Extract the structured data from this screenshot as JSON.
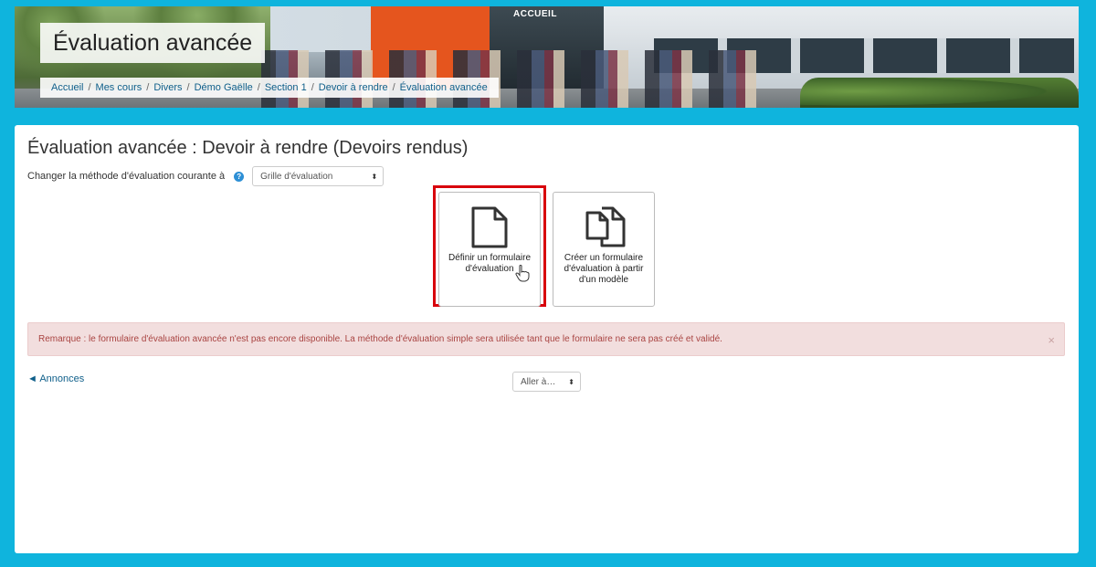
{
  "header": {
    "title": "Évaluation avancée",
    "banner_sign": "ACCUEIL",
    "breadcrumb": [
      "Accueil",
      "Mes cours",
      "Divers",
      "Démo Gaëlle",
      "Section 1",
      "Devoir à rendre",
      "Évaluation avancée"
    ],
    "breadcrumb_separator": "/"
  },
  "main": {
    "title": "Évaluation avancée : Devoir à rendre (Devoirs rendus)",
    "method_label": "Changer la méthode d'évaluation courante à",
    "method_select_value": "Grille d'évaluation",
    "tiles": [
      {
        "label": "Définir un formulaire d'évaluation",
        "icon": "document-icon"
      },
      {
        "label": "Créer un formulaire d'évaluation à partir d'un modèle",
        "icon": "copy-documents-icon"
      }
    ],
    "alert": {
      "text": "Remarque : le formulaire d'évaluation avancée n'est pas encore disponible. La méthode d'évaluation simple sera utilisée tant que le formulaire ne sera pas créé et validé.",
      "close": "×"
    },
    "prev_link": "◄ Annonces",
    "jump_select_value": "Aller à…"
  },
  "colors": {
    "background": "#0fb4dd",
    "link": "#0f5f8a",
    "alert_bg": "#f2dede",
    "alert_text": "#a94442",
    "highlight": "#d8000c"
  }
}
